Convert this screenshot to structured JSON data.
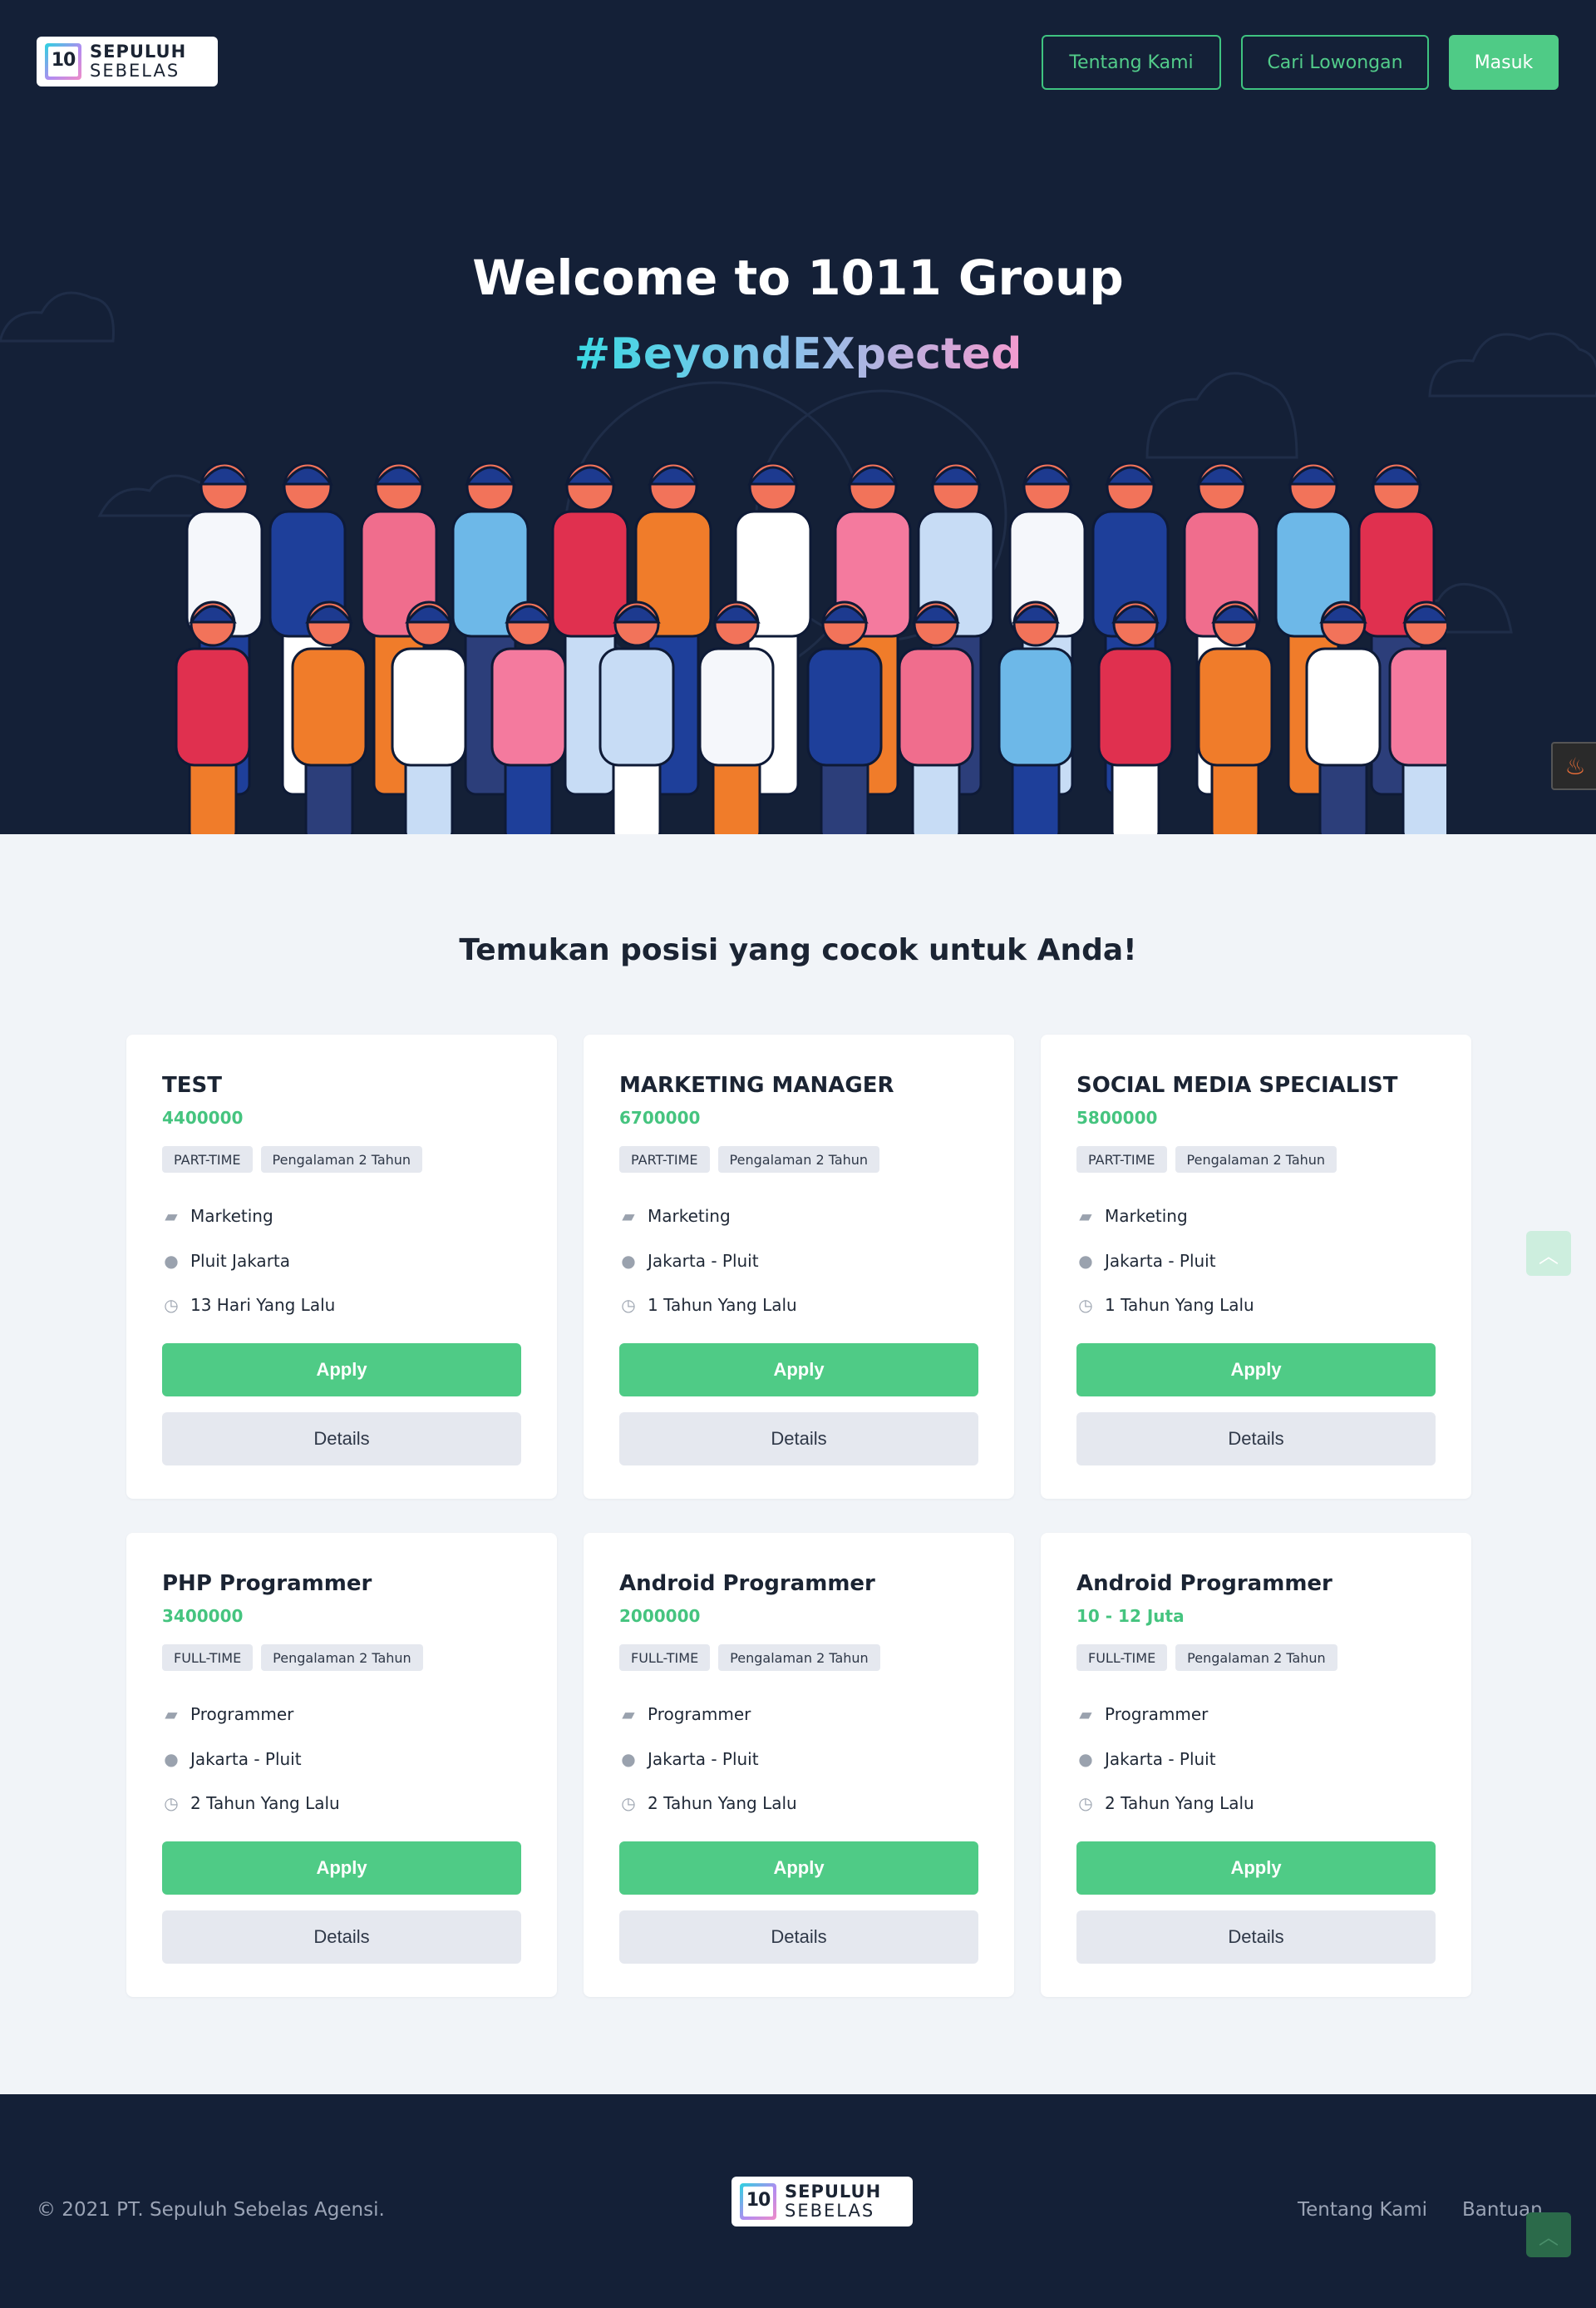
{
  "header": {
    "logo": {
      "line1": "SEPULUH",
      "line2": "SEBELAS",
      "mark": "10"
    },
    "nav": [
      {
        "label": "Tentang Kami"
      },
      {
        "label": "Cari Lowongan"
      },
      {
        "label": "Masuk"
      }
    ]
  },
  "hero": {
    "title": "Welcome to 1011 Group",
    "tagline": "#BeyondEXpected"
  },
  "main": {
    "title": "Temukan posisi yang cocok untuk Anda!",
    "apply_label": "Apply",
    "details_label": "Details",
    "jobs": [
      {
        "title": "TEST",
        "salary": "4400000",
        "type": "PART-TIME",
        "experience": "Pengalaman 2 Tahun",
        "category": "Marketing",
        "location": "Pluit Jakarta",
        "posted": "13 Hari Yang Lalu"
      },
      {
        "title": "MARKETING MANAGER",
        "salary": "6700000",
        "type": "PART-TIME",
        "experience": "Pengalaman 2 Tahun",
        "category": "Marketing",
        "location": "Jakarta - Pluit",
        "posted": "1 Tahun Yang Lalu"
      },
      {
        "title": "SOCIAL MEDIA SPECIALIST",
        "salary": "5800000",
        "type": "PART-TIME",
        "experience": "Pengalaman 2 Tahun",
        "category": "Marketing",
        "location": "Jakarta - Pluit",
        "posted": "1 Tahun Yang Lalu"
      },
      {
        "title": "PHP Programmer",
        "salary": "3400000",
        "type": "FULL-TIME",
        "experience": "Pengalaman 2 Tahun",
        "category": "Programmer",
        "location": "Jakarta - Pluit",
        "posted": "2 Tahun Yang Lalu"
      },
      {
        "title": "Android Programmer",
        "salary": "2000000",
        "type": "FULL-TIME",
        "experience": "Pengalaman 2 Tahun",
        "category": "Programmer",
        "location": "Jakarta - Pluit",
        "posted": "2 Tahun Yang Lalu"
      },
      {
        "title": "Android Programmer",
        "salary": "10 - 12 Juta",
        "type": "FULL-TIME",
        "experience": "Pengalaman 2 Tahun",
        "category": "Programmer",
        "location": "Jakarta - Pluit",
        "posted": "2 Tahun Yang Lalu"
      }
    ]
  },
  "footer": {
    "copyright": "© 2021 PT. Sepuluh Sebelas Agensi.",
    "links": [
      {
        "label": "Tentang Kami"
      },
      {
        "label": "Bantuan"
      }
    ]
  },
  "colors": {
    "navy": "#142037",
    "accent": "#4fcb86",
    "page_bg": "#f1f4f8"
  }
}
